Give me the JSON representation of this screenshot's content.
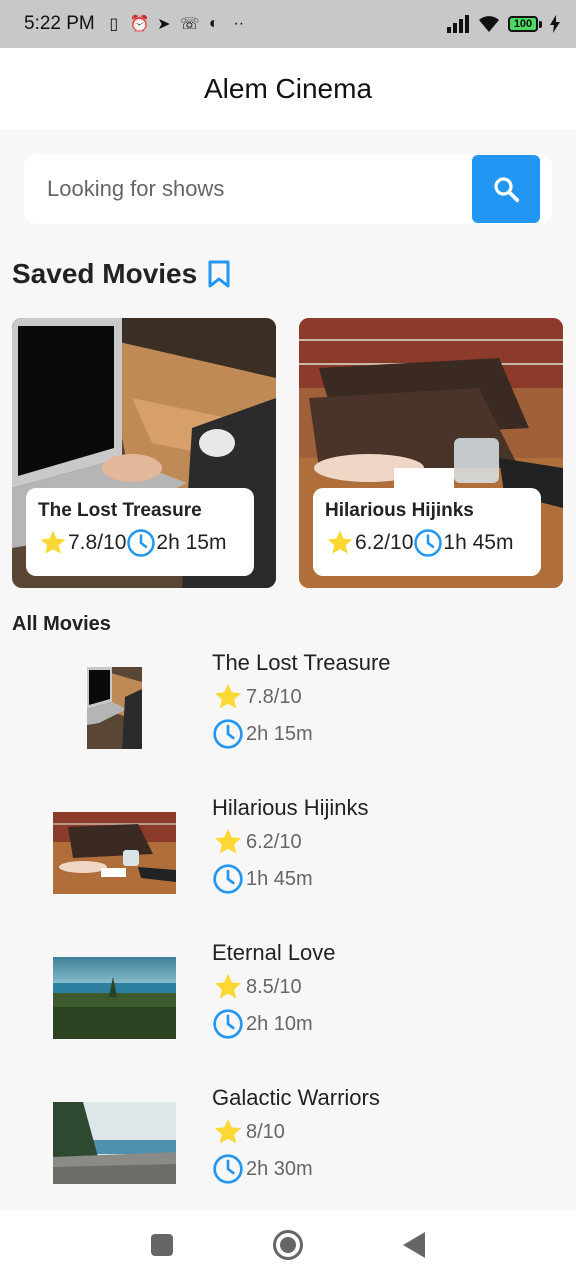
{
  "status_bar": {
    "time": "5:22 PM",
    "icons": [
      "vibrate-icon",
      "alarm-icon",
      "telegram-icon",
      "missed-call-icon",
      "data-saver-icon",
      "more-dots-icon"
    ],
    "battery": "100"
  },
  "app": {
    "title": "Alem Cinema"
  },
  "search": {
    "placeholder": "Looking for shows"
  },
  "saved": {
    "title": "Saved Movies",
    "items": [
      {
        "title": "The Lost Treasure",
        "rating": "7.8/10",
        "duration": "2h 15m"
      },
      {
        "title": "Hilarious Hijinks",
        "rating": "6.2/10",
        "duration": "1h 45m"
      }
    ]
  },
  "all": {
    "title": "All Movies",
    "items": [
      {
        "title": "The Lost Treasure",
        "rating": "7.8/10",
        "duration": "2h 15m"
      },
      {
        "title": "Hilarious Hijinks",
        "rating": "6.2/10",
        "duration": "1h 45m"
      },
      {
        "title": "Eternal Love",
        "rating": "8.5/10",
        "duration": "2h 10m"
      },
      {
        "title": "Galactic Warriors",
        "rating": "8/10",
        "duration": "2h 30m"
      }
    ]
  },
  "colors": {
    "accent": "#2196f3",
    "star": "#fdd835"
  }
}
